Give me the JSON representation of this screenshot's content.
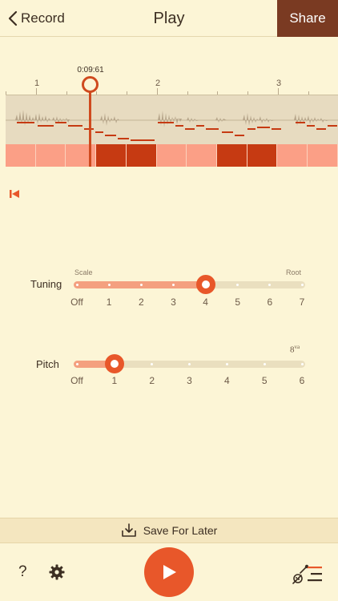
{
  "header": {
    "back_label": "Record",
    "title": "Play",
    "share_label": "Share"
  },
  "timeline": {
    "playhead_time": "0:09:61",
    "ruler_marks": [
      "1",
      "2",
      "3"
    ],
    "segments_selected": [
      false,
      false,
      false,
      true,
      true,
      false,
      false,
      true,
      true,
      false,
      false
    ],
    "colors": {
      "selected": "#c63a12",
      "unselected": "#fb9f86"
    }
  },
  "tuning": {
    "label": "Tuning",
    "left_caption": "Scale",
    "right_caption": "Root",
    "ticks": [
      "Off",
      "1",
      "2",
      "3",
      "4",
      "5",
      "6",
      "7"
    ],
    "value_index": 4
  },
  "pitch": {
    "label": "Pitch",
    "marker_label": "8",
    "marker_sup": "va",
    "ticks": [
      "Off",
      "1",
      "2",
      "3",
      "4",
      "5",
      "6"
    ],
    "value_index": 1
  },
  "footer": {
    "save_label": "Save For Later",
    "help_label": "?"
  },
  "colors": {
    "accent": "#e8572a",
    "share_bg": "#7a3a22",
    "background": "#fcf5d6"
  }
}
